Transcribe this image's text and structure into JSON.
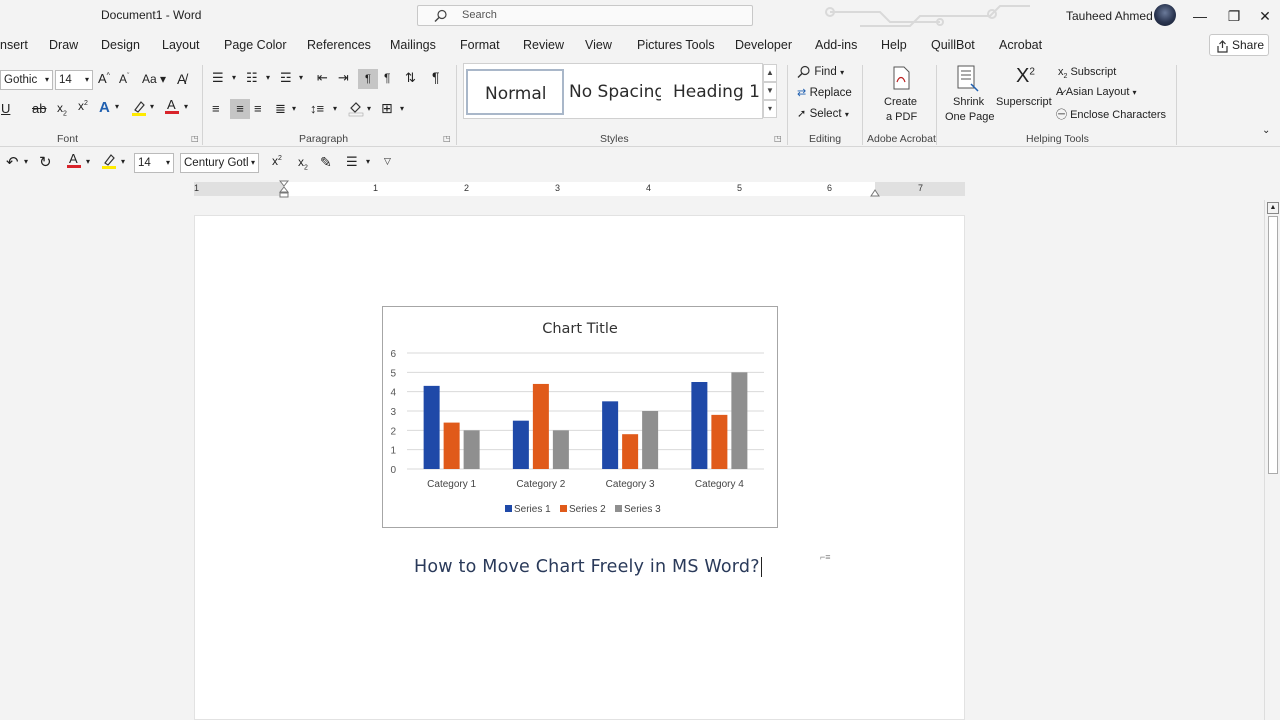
{
  "window": {
    "title": "Document1  -  Word",
    "search_placeholder": "Search",
    "user": "Tauheed Ahmed",
    "minimize": "—",
    "restore": "❐",
    "close": "✕"
  },
  "tabs": [
    "nsert",
    "Draw",
    "Design",
    "Layout",
    "Page Color",
    "References",
    "Mailings",
    "Format",
    "Review",
    "View",
    "Pictures Tools",
    "Developer",
    "Add-ins",
    "Help",
    "QuillBot",
    "Acrobat"
  ],
  "share_label": "Share",
  "ribbon": {
    "font_name": "Gothic",
    "font_size": "14",
    "case_label": "Aa",
    "styles": [
      "Normal",
      "No Spacing",
      "Heading 1"
    ],
    "editing": {
      "find": "Find",
      "replace": "Replace",
      "select": "Select"
    },
    "acrobat": {
      "create_pdf_line1": "Create",
      "create_pdf_line2": "a PDF"
    },
    "helping": {
      "shrink_line1": "Shrink",
      "shrink_line2": "One Page",
      "superscript": "Superscript",
      "subscript": "Subscript",
      "asian_layout": "Asian Layout",
      "enclose": "Enclose Characters"
    },
    "group_labels": {
      "font": "Font",
      "paragraph": "Paragraph",
      "styles": "Styles",
      "editing": "Editing",
      "acrobat": "Adobe Acrobat",
      "helping": "Helping Tools"
    }
  },
  "qat": {
    "font_size": "14",
    "font_name": "Century Gotl"
  },
  "ruler_numbers": [
    "1",
    "1",
    "2",
    "3",
    "4",
    "5",
    "6",
    "7"
  ],
  "document": {
    "heading": "How to Move Chart Freely in MS Word?"
  },
  "colors": {
    "series1": "#1f49a8",
    "series2": "#e05a1a",
    "series3": "#8f8f8f"
  },
  "chart_data": {
    "type": "bar",
    "title": "Chart Title",
    "categories": [
      "Category 1",
      "Category 2",
      "Category 3",
      "Category 4"
    ],
    "series": [
      {
        "name": "Series 1",
        "values": [
          4.3,
          2.5,
          3.5,
          4.5
        ]
      },
      {
        "name": "Series 2",
        "values": [
          2.4,
          4.4,
          1.8,
          2.8
        ]
      },
      {
        "name": "Series 3",
        "values": [
          2,
          2,
          3,
          5
        ]
      }
    ],
    "ylim": [
      0,
      6
    ],
    "yticks": [
      "0",
      "1",
      "2",
      "3",
      "4",
      "5",
      "6"
    ],
    "grid": true,
    "legend": "bottom"
  }
}
